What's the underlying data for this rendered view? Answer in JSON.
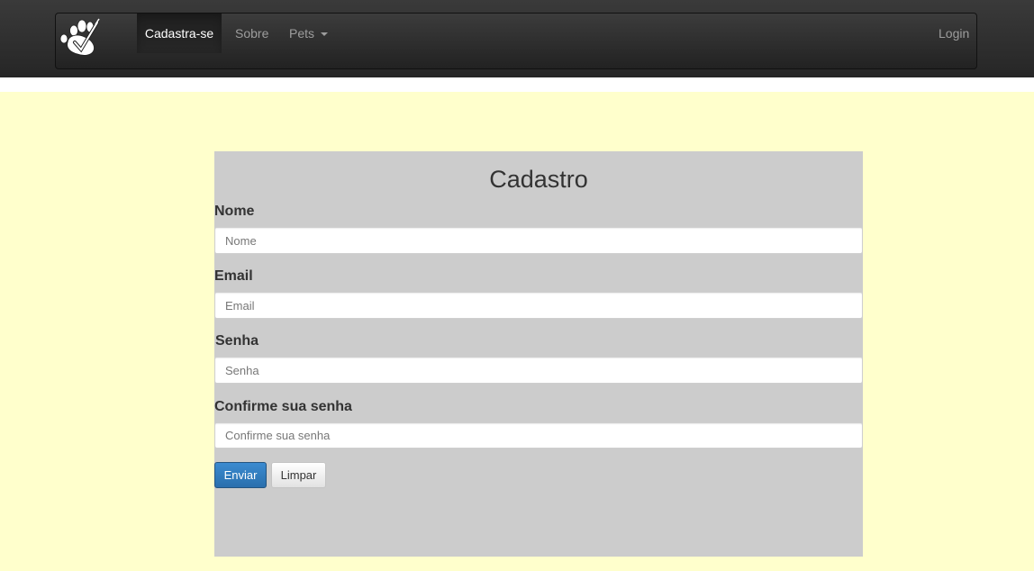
{
  "nav": {
    "brand_icon": "paw-check-icon",
    "items": [
      {
        "label": "Cadastra-se"
      },
      {
        "label": "Sobre"
      },
      {
        "label": "Pets"
      }
    ],
    "login_label": "Login"
  },
  "form": {
    "title": "Cadastro",
    "fields": [
      {
        "label": "Nome",
        "placeholder": "Nome"
      },
      {
        "label": "Email",
        "placeholder": "Email"
      },
      {
        "label": "Senha",
        "placeholder": "Senha"
      },
      {
        "label": "Confirme sua senha",
        "placeholder": "Confirme sua senha"
      }
    ],
    "submit_label": "Enviar",
    "clear_label": "Limpar"
  },
  "colors": {
    "page_background": "#ffffcc",
    "panel_background": "#cccccc",
    "primary_button": "#337ab7",
    "navbar": "#222222"
  }
}
